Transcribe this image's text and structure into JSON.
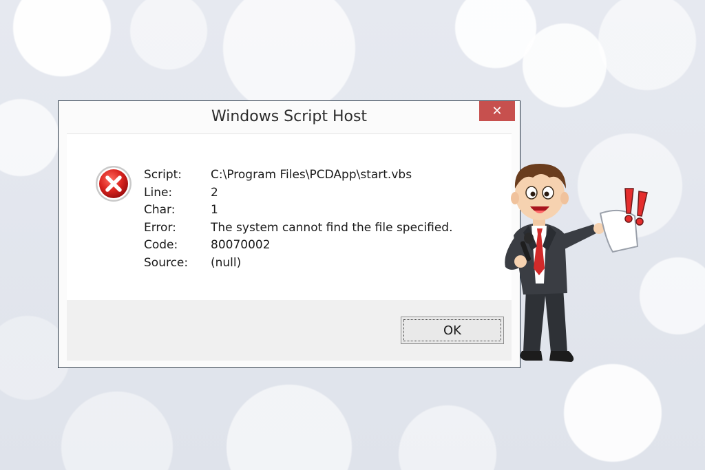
{
  "dialog": {
    "title": "Windows Script Host",
    "close_label": "✕",
    "rows": [
      {
        "label": "Script:",
        "value": "C:\\Program Files\\PCDApp\\start.vbs"
      },
      {
        "label": "Line:",
        "value": "2"
      },
      {
        "label": "Char:",
        "value": "1"
      },
      {
        "label": "Error:",
        "value": "The system cannot find the file specified."
      },
      {
        "label": "Code:",
        "value": "80070002"
      },
      {
        "label": "Source:",
        "value": "(null)"
      }
    ],
    "ok_label": "OK"
  },
  "icons": {
    "error": "error-x-icon",
    "close": "close-icon"
  },
  "colors": {
    "close_button": "#c7504e",
    "error_icon": "#d2242a",
    "tie": "#d22a2a",
    "exclamation": "#e52d2d"
  }
}
